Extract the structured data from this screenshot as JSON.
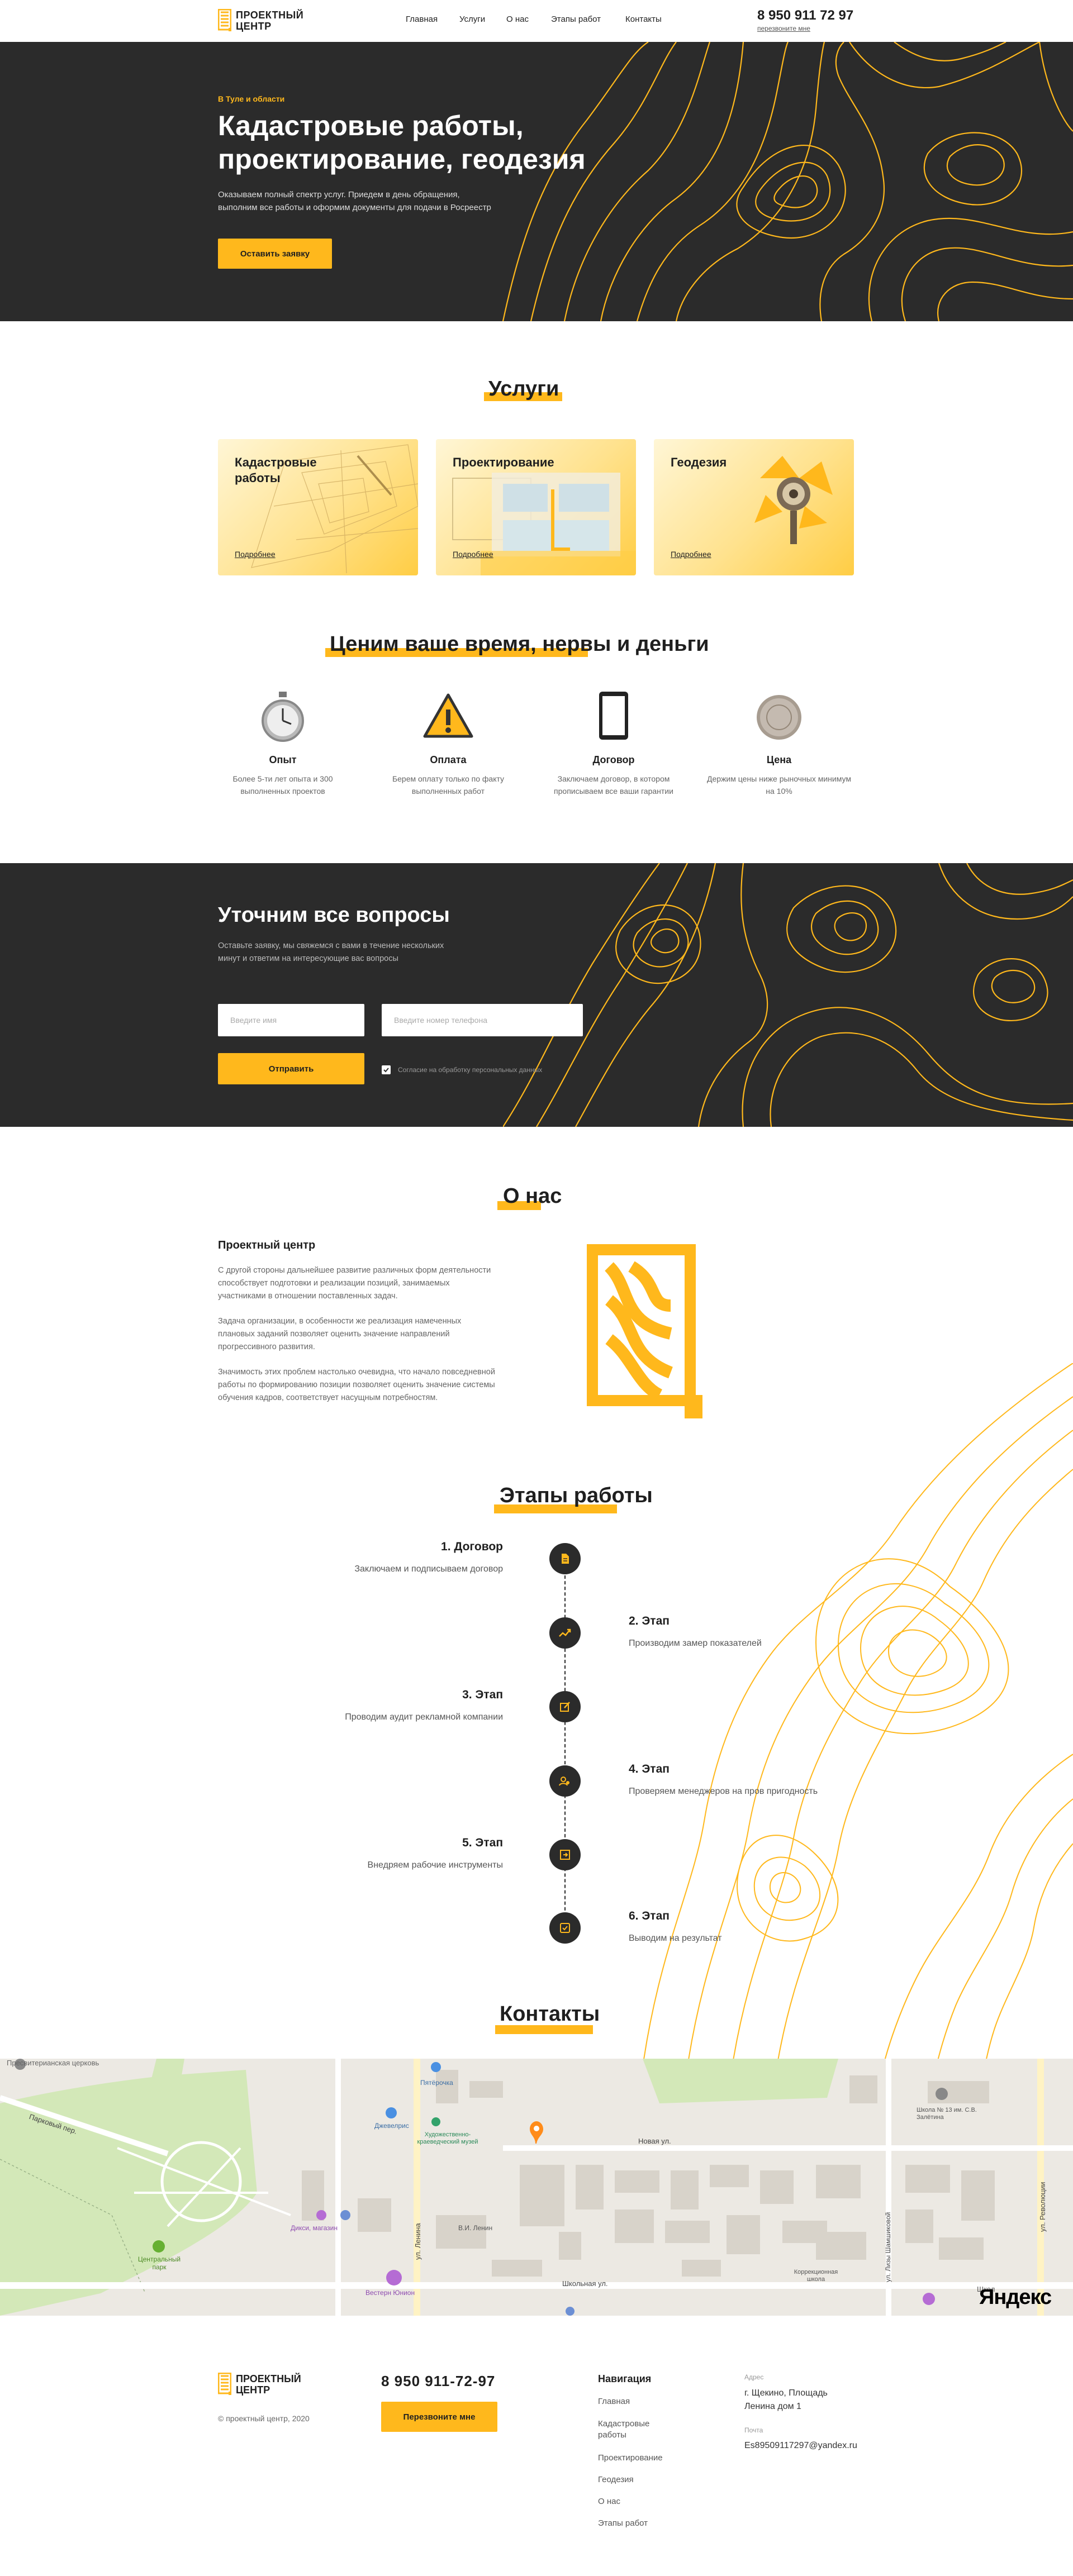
{
  "header": {
    "logo_line1": "ПРОЕКТНЫЙ",
    "logo_line2": "ЦЕНТР",
    "nav": [
      "Главная",
      "Услуги",
      "О нас",
      "Этапы работ",
      "Контакты"
    ],
    "phone": "8 950 911 72 97",
    "callback": "перезвоните мне"
  },
  "hero": {
    "region": "В Туле и области",
    "title_line1": "Кадастровые работы,",
    "title_line2": "проектирование, геодезия",
    "subtitle_line1": "Оказываем полный спектр услуг. Приедем в день обращения,",
    "subtitle_line2": "выполним все работы и оформим документы для подачи в Росреестр",
    "cta": "Оставить заявку"
  },
  "services": {
    "title": "Услуги",
    "cards": [
      {
        "title": "Кадастровые работы",
        "more": "Подробнее"
      },
      {
        "title": "Проектирование",
        "more": "Подробнее"
      },
      {
        "title": "Геодезия",
        "more": "Подробнее"
      }
    ]
  },
  "values": {
    "title": "Ценим ваше время, нервы и деньги",
    "items": [
      {
        "icon": "stopwatch-icon",
        "title": "Опыт",
        "desc": "Более 5-ти лет опыта и 300 выполненных проектов"
      },
      {
        "icon": "warning-icon",
        "title": "Оплата",
        "desc": "Берем оплату только по факту выполненных работ"
      },
      {
        "icon": "tablet-icon",
        "title": "Договор",
        "desc": "Заключаем договор, в котором прописываем все ваши гарантии"
      },
      {
        "icon": "coin-icon",
        "title": "Цена",
        "desc": "Держим цены ниже рыночных минимум на 10%"
      }
    ]
  },
  "questions": {
    "title": "Уточним все вопросы",
    "subtitle_line1": "Оставьте заявку, мы свяжемся с вами в течение нескольких",
    "subtitle_line2": "минут и ответим на интересующие вас вопросы",
    "name_placeholder": "Введите имя",
    "phone_placeholder": "Введите номер телефона",
    "submit": "Отправить",
    "consent": "Согласие на обработку персональных данных"
  },
  "about": {
    "title": "О нас",
    "company": "Проектный центр",
    "p1": "С другой стороны дальнейшее развитие различных форм деятельности способствует подготовки и реализации позиций, занимаемых участниками в отношении поставленных задач.",
    "p2": "Задача организации, в особенности же реализация намеченных плановых заданий позволяет оценить значение направлений прогрессивного развития.",
    "p3": "Значимость этих проблем настолько очевидна, что начало повседневной работы по формированию позиции позволяет оценить значение системы обучения кадров, соответствует насущным потребностям."
  },
  "stages": {
    "title": "Этапы работы",
    "items": [
      {
        "title": "1. Договор",
        "desc": "Заключаем и подписываем договор",
        "icon": "document-icon"
      },
      {
        "title": "2. Этап",
        "desc": "Производим замер показателей",
        "icon": "chart-icon"
      },
      {
        "title": "3. Этап",
        "desc": "Проводим аудит рекламной компании",
        "icon": "edit-icon"
      },
      {
        "title": "4. Этап",
        "desc": "Проверяем менеджеров на пров пригодность",
        "icon": "users-icon"
      },
      {
        "title": "5. Этап",
        "desc": "Внедряем рабочие инструменты",
        "icon": "export-icon"
      },
      {
        "title": "6. Этап",
        "desc": "Выводим на результат",
        "icon": "check-icon"
      }
    ]
  },
  "contacts": {
    "title": "Контакты",
    "map": {
      "labels": {
        "church": "Пресвитерианская церковь",
        "parkovy": "Парковый пер.",
        "pyaterochka": "Пятёрочка",
        "jewelry": "Джевелрис",
        "museum": "Художественно-краеведческий музей",
        "dixi": "Дикси, магазин",
        "lenin_st": "ул. Ленина",
        "lenin_monument": "В.И. Ленин",
        "central_park": "Центральный парк",
        "vestern": "Вестерн Юнион",
        "novaya": "Новая ул.",
        "school13": "Школа № 13 им. С.В. Залётина",
        "shkolnaya": "Школьная ул.",
        "lizy": "ул. Лизы Шамшиковой",
        "correction": "Коррекционная школа",
        "revolution": "ул. Революции",
        "school_short": "Школ",
        "yandex": "Яндекс"
      }
    }
  },
  "footer": {
    "logo_line1": "ПРОЕКТНЫЙ",
    "logo_line2": "ЦЕНТР",
    "copyright": "© проектный центр, 2020",
    "phone": "8 950 911-72-97",
    "callback": "Перезвоните мне",
    "nav_title": "Навигация",
    "nav": [
      "Главная",
      "Кадастровые работы",
      "Проектирование",
      "Геодезия",
      "О нас",
      "Этапы работ"
    ],
    "address_label": "Адрес",
    "address_line1": "г. Щекино, Площадь",
    "address_line2": "Ленина дом 1",
    "email_label": "Почта",
    "email": "Es89509117297@yandex.ru"
  },
  "colors": {
    "accent": "#ffb81c",
    "dark": "#2b2b2b"
  }
}
